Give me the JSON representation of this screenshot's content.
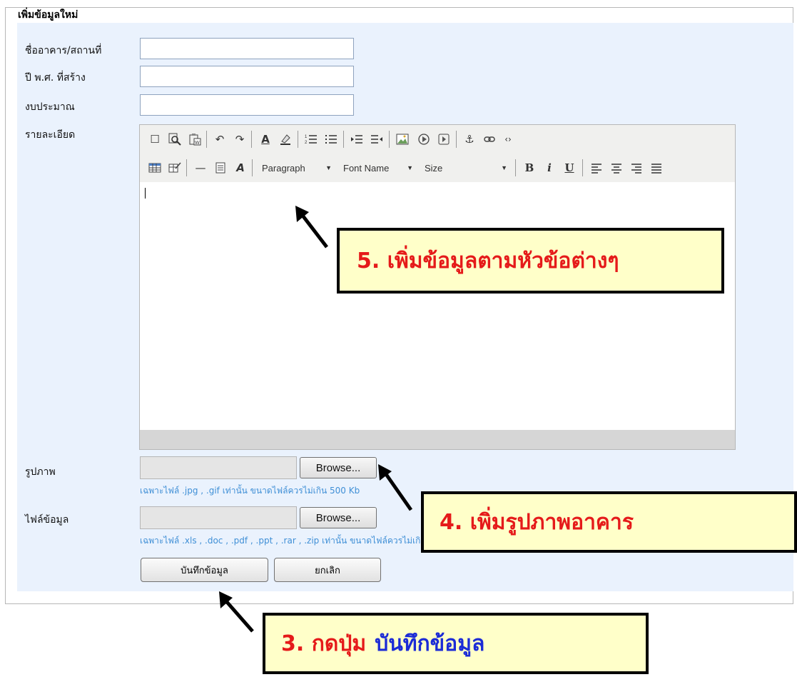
{
  "form": {
    "legend": "เพิ่มข้อมูลใหม่",
    "fields": {
      "building_name_label": "ชื่ออาคาร/สถานที่",
      "year_built_label": "ปี พ.ศ. ที่สร้าง",
      "budget_label": "งบประมาณ",
      "details_label": "รายละเอียด",
      "image_label": "รูปภาพ",
      "data_file_label": "ไฟล์ข้อมูล"
    },
    "values": {
      "building_name": "",
      "year_built": "",
      "budget": ""
    },
    "editor": {
      "format_select": "Paragraph",
      "font_select": "Font Name",
      "size_select": "Size",
      "toolbar_row1_icons": [
        "new-document-icon",
        "preview-icon",
        "paste-word-icon",
        "undo-icon",
        "redo-icon",
        "text-color-icon",
        "highlight-color-icon",
        "ordered-list-icon",
        "unordered-list-icon",
        "indent-icon",
        "outdent-icon",
        "image-icon",
        "insert-media-icon",
        "flash-icon",
        "anchor-icon",
        "link-icon",
        "source-code-icon"
      ],
      "toolbar_row2_icons": [
        "table-icon",
        "table-properties-icon",
        "horizontal-rule-icon",
        "template-icon",
        "remove-format-icon",
        "bold-icon",
        "italic-icon",
        "underline-icon",
        "align-left-icon",
        "align-center-icon",
        "align-right-icon",
        "justify-icon"
      ]
    },
    "image_browse_label": "Browse...",
    "image_hint": "เฉพาะไฟล์ .jpg , .gif เท่านั้น ขนาดไฟล์ควรไม่เกิน 500 Kb",
    "file_browse_label": "Browse...",
    "file_hint": "เฉพาะไฟล์ .xls , .doc , .pdf , .ppt , .rar , .zip เท่านั้น ขนาดไฟล์ควรไม่เกิน 500 Kb",
    "save_button": "บันทึกข้อมูล",
    "cancel_button": "ยกเลิก"
  },
  "callouts": {
    "step5": "5. เพิ่มข้อมูลตามหัวข้อต่างๆ",
    "step4": "4. เพิ่มรูปภาพอาคาร",
    "step3_prefix": "3. กดปุ่ม",
    "step3_target": "บันทึกข้อมูล"
  },
  "colors": {
    "callout_bg": "#ffffc9",
    "callout_text": "#e51a1a",
    "callout_highlight": "#1c2bd6",
    "panel_bg": "#eaf2fd",
    "hint_text": "#3f8fd6"
  }
}
